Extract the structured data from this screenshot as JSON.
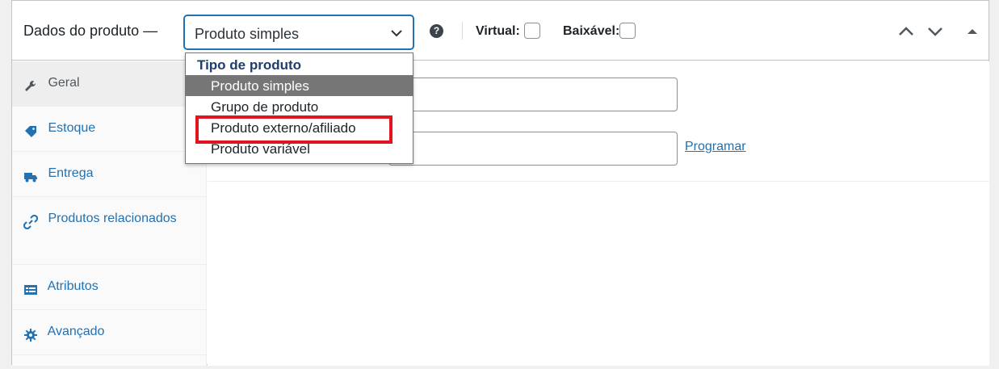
{
  "header": {
    "title": "Dados do produto —",
    "product_type_value": "Produto simples",
    "virtual_label": "Virtual:",
    "downloadable_label": "Baixável:"
  },
  "tabs": [
    {
      "label": "Geral",
      "icon": "wrench-icon",
      "active": true
    },
    {
      "label": "Estoque",
      "icon": "tag-icon",
      "active": false
    },
    {
      "label": "Entrega",
      "icon": "truck-icon",
      "active": false
    },
    {
      "label": "Produtos relacionados",
      "icon": "link-icon",
      "active": false
    },
    {
      "label": "Atributos",
      "icon": "list-icon",
      "active": false
    },
    {
      "label": "Avançado",
      "icon": "gear-icon",
      "active": false
    }
  ],
  "content": {
    "schedule_link": "Programar"
  },
  "dropdown": {
    "group_label": "Tipo de produto",
    "options": [
      {
        "label": "Produto simples",
        "selected": true
      },
      {
        "label": "Grupo de produto",
        "selected": false
      },
      {
        "label": "Produto externo/afiliado",
        "selected": false,
        "highlighted": true
      },
      {
        "label": "Produto variável",
        "selected": false
      }
    ]
  },
  "colors": {
    "accent": "#2271b1",
    "highlight": "#e1141f",
    "selected_option_bg": "#767676"
  }
}
